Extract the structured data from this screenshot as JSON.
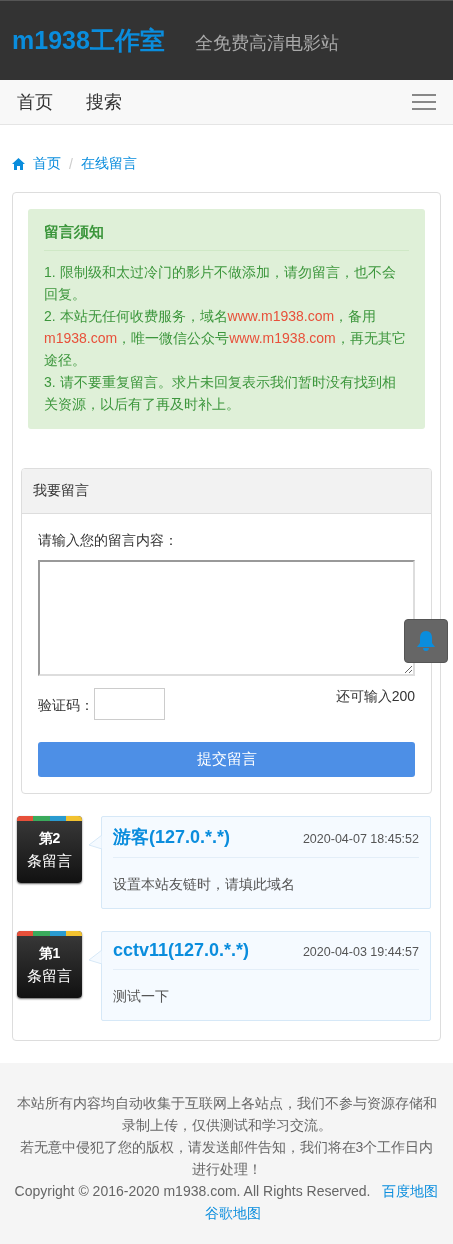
{
  "header": {
    "logo": "m1938工作室",
    "tagline": "全免费高清电影站"
  },
  "nav": {
    "items": [
      "首页",
      "搜索"
    ]
  },
  "breadcrumb": {
    "separator": "/",
    "items": [
      {
        "label": "首页",
        "kind": "home"
      },
      {
        "label": "在线留言",
        "kind": "page"
      }
    ]
  },
  "notice": {
    "title": "留言须知",
    "paragraphs": [
      [
        {
          "text": "1. 限制级和太过冷门的影片不做添加，请勿留言，也不会回复。",
          "highlight": false
        }
      ],
      [
        {
          "text": "2. 本站无任何收费服务，域名",
          "highlight": false
        },
        {
          "text": "www.m1938.com",
          "highlight": true
        },
        {
          "text": "，备用",
          "highlight": false
        },
        {
          "text": "m1938.com",
          "highlight": true
        },
        {
          "text": "，唯一微信公众号",
          "highlight": false
        },
        {
          "text": "www.m1938.com",
          "highlight": true
        },
        {
          "text": "，再无其它途径。",
          "highlight": false
        }
      ],
      [
        {
          "text": "3. 请不要重复留言。求片未回复表示我们暂时没有找到相关资源，以后有了再及时补上。",
          "highlight": false
        }
      ]
    ]
  },
  "form": {
    "title": "我要留言",
    "content_label": "请输入您的留言内容：",
    "captcha_label": "验证码：",
    "remaining": "还可输入200",
    "submit": "提交留言"
  },
  "messages": [
    {
      "badge_top": "第2",
      "badge_bottom": "条留言",
      "author": "游客(127.0.*.*)",
      "time": "2020-04-07 18:45:52",
      "text": "设置本站友链时，请填此域名"
    },
    {
      "badge_top": "第1",
      "badge_bottom": "条留言",
      "author": "cctv11(127.0.*.*)",
      "time": "2020-04-03 19:44:57",
      "text": "测试一下"
    }
  ],
  "footer": {
    "lines": [
      "本站所有内容均自动收集于互联网上各站点，我们不参与资源存储和录制上传，仅供测试和学习交流。",
      "若无意中侵犯了您的版权，请发送邮件告知，我们将在3个工作日内进行处理！"
    ],
    "copyright": "Copyright © 2016-2020 m1938.com. All Rights Reserved.",
    "links": [
      "百度地图",
      "谷歌地图"
    ]
  }
}
